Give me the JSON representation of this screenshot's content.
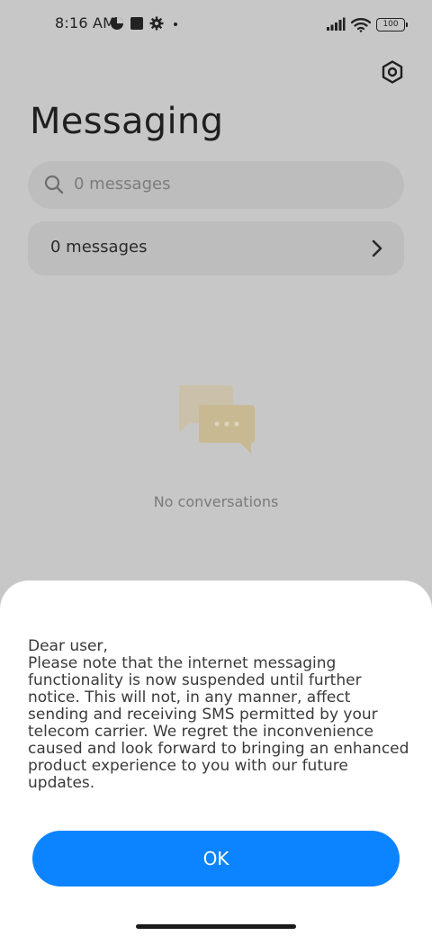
{
  "status_bar": {
    "time": "8:16 AM",
    "battery": "100",
    "icons": [
      "pie-chart-icon",
      "square-app-icon",
      "gear-icon",
      "dot-icon",
      "signal-icon",
      "wifi-icon",
      "battery-icon"
    ]
  },
  "header": {
    "title": "Messaging",
    "settings_icon": "hexagon-settings-icon"
  },
  "search": {
    "placeholder": "0 messages",
    "icon": "search-icon"
  },
  "messages_row": {
    "label": "0 messages",
    "icon": "chevron-right-icon"
  },
  "empty_state": {
    "icon": "chat-bubbles-icon",
    "text": "No conversations"
  },
  "dialog": {
    "greeting": "Dear user,",
    "body": "Please note that the internet messaging functionality is now suspended until further notice. This will not, in any manner, affect sending and receiving SMS permitted by your telecom carrier. We regret the inconvenience caused and look forward to bringing an enhanced product experience to you with our future updates.",
    "ok_label": "OK"
  },
  "colors": {
    "scrim_background": "#c7c7c7",
    "accent": "#0d84ff",
    "dialog_background": "#ffffff"
  }
}
